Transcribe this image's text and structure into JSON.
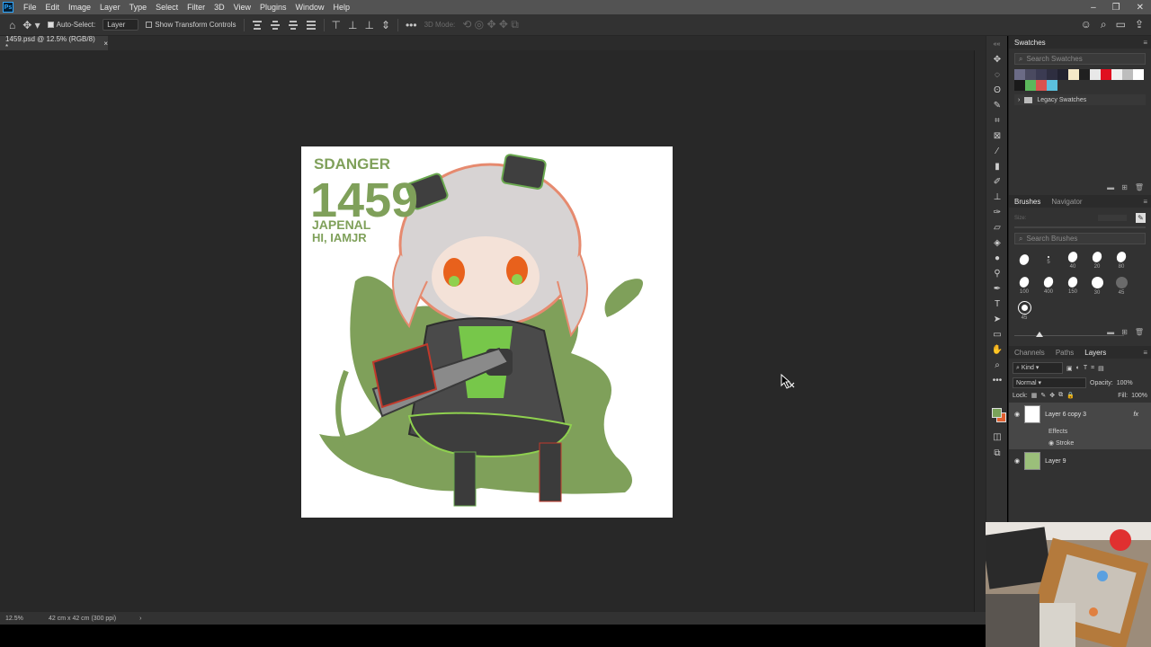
{
  "menubar": {
    "app_icon": "Ps",
    "items": [
      "File",
      "Edit",
      "Image",
      "Layer",
      "Type",
      "Select",
      "Filter",
      "3D",
      "View",
      "Plugins",
      "Window",
      "Help"
    ],
    "window_controls": [
      "minimize-icon",
      "restore-icon",
      "close-icon"
    ]
  },
  "options": {
    "auto_select_label": "Auto-Select:",
    "auto_select_checked": true,
    "auto_select_target": "Layer",
    "transform_controls_label": "Show Transform Controls",
    "more_label": "•••",
    "mode_3d_label": "3D Mode:"
  },
  "document": {
    "tab_title": "1459.psd @ 12.5% (RGB/8) *",
    "tab_close": "×"
  },
  "status": {
    "zoom": "12.5%",
    "dimensions": "42 cm x 42 cm (300 ppi)",
    "arrow": "›"
  },
  "swatches_panel": {
    "title": "Swatches",
    "search_placeholder": "Search Swatches",
    "colors_row1": [
      "#6b6b86",
      "#4a4a60",
      "#3b3b52",
      "#2e2e40",
      "#222230",
      "#f5e9c8",
      "#202020",
      "#e8e8e8",
      "#e01020",
      "#f0f0f0",
      "#bdbdbd",
      "#ffffff",
      "#1a1a1a"
    ],
    "colors_row2": [
      "#5cb85c",
      "#d9534f",
      "#5bc0de"
    ],
    "folder_label": "Legacy Swatches"
  },
  "brushes_panel": {
    "tabs": [
      "Brushes",
      "Navigator"
    ],
    "size_label": "Size:",
    "search_placeholder": "Search Brushes",
    "brushes": [
      {
        "size": ""
      },
      {
        "size": "5"
      },
      {
        "size": "40"
      },
      {
        "size": "20"
      },
      {
        "size": "80"
      },
      {
        "size": "100"
      },
      {
        "size": "400"
      },
      {
        "size": "150"
      },
      {
        "size": "30"
      },
      {
        "size": "45"
      },
      {
        "size": "45"
      }
    ]
  },
  "layers_panel": {
    "tabs": [
      "Channels",
      "Paths",
      "Layers"
    ],
    "filter_kind": "Kind",
    "blend_mode": "Normal",
    "opacity_label": "Opacity:",
    "opacity_value": "100%",
    "lock_label": "Lock:",
    "fill_label": "Fill:",
    "fill_value": "100%",
    "layers": [
      {
        "name": "Layer 6 copy 3",
        "fx": "fx",
        "effects_label": "Effects",
        "effect": "Stroke"
      },
      {
        "name": "Layer 9"
      }
    ]
  },
  "artwork": {
    "text_line1": "SDANGER",
    "text_line2": "1459",
    "text_line3": "JAPENAL",
    "text_line4": "HI, IAMJR",
    "accent": "#7fa05a"
  }
}
